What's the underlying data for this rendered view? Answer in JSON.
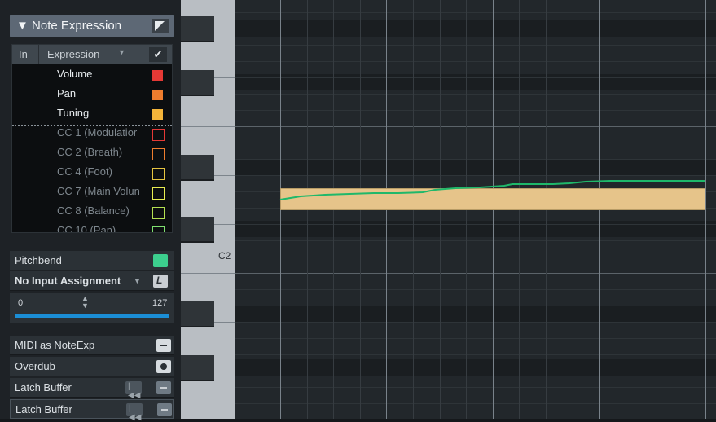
{
  "inspector": {
    "section_title": "Note Expression",
    "list_header": {
      "in": "In",
      "expression": "Expression",
      "check": "✔"
    },
    "expressions": [
      {
        "label": "Volume",
        "color": "#e53935",
        "filled": true
      },
      {
        "label": "Pan",
        "color": "#ef7d2e",
        "filled": true
      },
      {
        "label": "Tuning",
        "color": "#f4b43a",
        "filled": true
      },
      {
        "label": "CC 1  (Modulatior",
        "color": "#e53935",
        "filled": false
      },
      {
        "label": "CC 2  (Breath)",
        "color": "#ef7d2e",
        "filled": false
      },
      {
        "label": "CC 4  (Foot)",
        "color": "#e6c440",
        "filled": false
      },
      {
        "label": "CC 7  (Main Volun",
        "color": "#e8ec50",
        "filled": false
      },
      {
        "label": "CC 8  (Balance)",
        "color": "#b4e050",
        "filled": false
      },
      {
        "label": "CC 10  (Pan)",
        "color": "#7fe070",
        "filled": false
      }
    ],
    "pitchbend": {
      "label": "Pitchbend",
      "color": "#3ccf8e"
    },
    "input_assignment": {
      "label": "No Input Assignment"
    },
    "range": {
      "min": "0",
      "max": "127"
    },
    "midi_as_noteexp": {
      "label": "MIDI as NoteExp"
    },
    "overdub": {
      "label": "Overdub"
    },
    "latch_buffer_1": {
      "label": "Latch Buffer"
    },
    "latch_buffer_2": {
      "label": "Latch Buffer"
    }
  },
  "keyboard": {
    "c2_label": "C2"
  },
  "editor": {
    "curve_color": "#1fb86a",
    "note_color": "#e6c48a"
  }
}
